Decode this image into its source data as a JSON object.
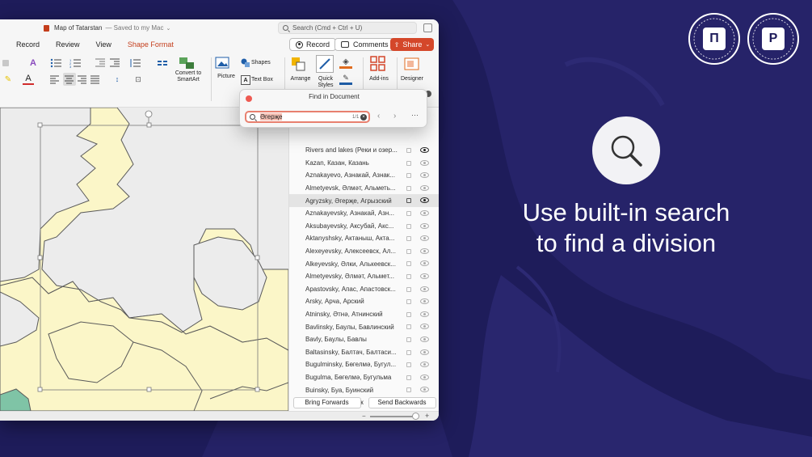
{
  "window": {
    "title": "Map of Tatarstan",
    "saved_status": "— Saved to my Mac",
    "search_placeholder": "Search (Cmd + Ctrl + U)"
  },
  "tabs": [
    {
      "label": "Record"
    },
    {
      "label": "Review"
    },
    {
      "label": "View"
    },
    {
      "label": "Shape Format"
    }
  ],
  "actions": {
    "record_label": "Record",
    "comments_label": "Comments",
    "share_label": "Share"
  },
  "ribbon": {
    "convert_label_1": "Convert to",
    "convert_label_2": "SmartArt",
    "picture_label": "Picture",
    "shapes_label": "Shapes",
    "textbox_label": "Text Box",
    "arrange_label": "Arrange",
    "quick_styles_label_1": "Quick",
    "quick_styles_label_2": "Styles",
    "addins_label": "Add-ins",
    "designer_label": "Designer"
  },
  "find": {
    "title": "Find in Document",
    "query": "Әгерҗе",
    "count": "1/1"
  },
  "selection_pane": {
    "items": [
      "Rivers and lakes (Реки и озер...",
      "Kazan, Казан, Казань",
      "Aznakayevo, Азнакай, Азнак...",
      "Almetyevsk, Әлмәт, Альметь...",
      "Agryzsky, Әгерҗе, Агрызский",
      "Aznakayevsky, Азнакай, Азн...",
      "Aksubayevsky, Аксубай, Акс...",
      "Aktanyshsky, Актаныш, Акта...",
      "Alexeyevsky, Алексеевск, Ал...",
      "Alkeyevsky, Әлки, Алькеевск...",
      "Almetyevsky, Әлмәт, Альмет...",
      "Apastovsky, Апас, Апастовск...",
      "Arsky, Арча, Арский",
      "Atninsky, Әтнә, Атнинский",
      "Bavlinsky, Баулы, Бавлинский",
      "Bavly, Баулы, Бавлы",
      "Baltasinsky, Балтач, Балтаси...",
      "Bugulminsky, Бөгелмә, Бугул...",
      "Bugulma, Бөгелмә, Бугульма",
      "Buinsky, Буа, Буинский",
      "Buinsk, Буа, Буинск"
    ],
    "selected_index": 4,
    "bring_forwards_label": "Bring Forwards",
    "send_backwards_label": "Send Backwards"
  },
  "promo": {
    "headline_line1": "Use built-in search",
    "headline_line2": "to find a division",
    "badge_left_letter": "П",
    "badge_right_letter": "P"
  },
  "colors": {
    "background": "#1e1c5a",
    "accent": "#c43e1c",
    "share_button": "#d4472a",
    "map_fill": "#fbf6c8",
    "map_other": "#ededed",
    "map_green": "#7fc4a6"
  }
}
